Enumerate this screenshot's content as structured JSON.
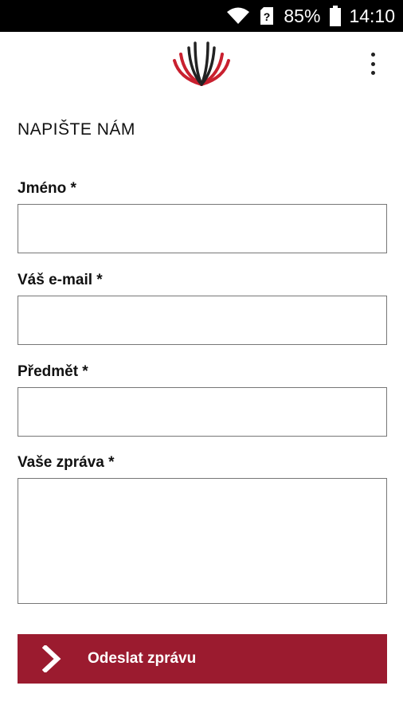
{
  "status_bar": {
    "battery_percent": "85%",
    "time": "14:10",
    "icons": [
      "wifi-icon",
      "sim-unknown-icon",
      "battery-icon"
    ]
  },
  "app_bar": {
    "logo": "brand-logo",
    "menu_icon": "overflow-menu-icon"
  },
  "form": {
    "title": "NAPIŠTE NÁM",
    "fields": {
      "name": {
        "label": "Jméno *",
        "value": "",
        "placeholder": ""
      },
      "email": {
        "label": "Váš e-mail *",
        "value": "",
        "placeholder": ""
      },
      "subject": {
        "label": "Předmět *",
        "value": "",
        "placeholder": ""
      },
      "message": {
        "label": "Vaše zpráva *",
        "value": "",
        "placeholder": ""
      }
    },
    "submit_label": "Odeslat zprávu"
  },
  "colors": {
    "accent": "#9b1b2f",
    "status_bar_bg": "#000000",
    "background": "#ffffff"
  }
}
